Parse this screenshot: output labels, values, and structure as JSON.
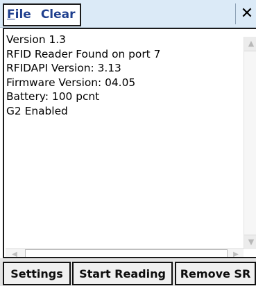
{
  "menu": {
    "file_prefix": "F",
    "file_rest": "ile",
    "clear_label": "Clear",
    "close_glyph": "✕"
  },
  "output": {
    "lines": [
      "Version 1.3",
      "RFID Reader Found on port 7",
      "RFIDAPI Version: 3.13",
      "Firmware Version: 04.05",
      "Battery: 100 pcnt",
      "G2  Enabled"
    ]
  },
  "scrollbars": {
    "up_icon": "scroll-up-arrow-icon",
    "down_icon": "scroll-down-arrow-icon",
    "left_icon": "scroll-left-arrow-icon",
    "right_icon": "scroll-right-arrow-icon"
  },
  "buttons": {
    "settings_label": "Settings",
    "start_label": "Start Reading",
    "remove_label": "Remove SR"
  }
}
